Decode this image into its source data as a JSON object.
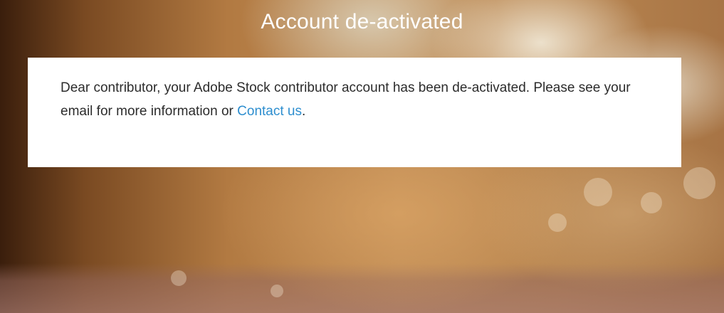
{
  "page": {
    "title": "Account de-activated"
  },
  "notice": {
    "message_before": "Dear contributor, your Adobe Stock contributor account has been de-activated. Please see your email for more information or ",
    "link_text": "Contact us",
    "message_after": "."
  },
  "colors": {
    "link": "#2d8ecf",
    "card_background": "#ffffff",
    "title_text": "#ffffff",
    "body_text": "#2c2c2c"
  }
}
